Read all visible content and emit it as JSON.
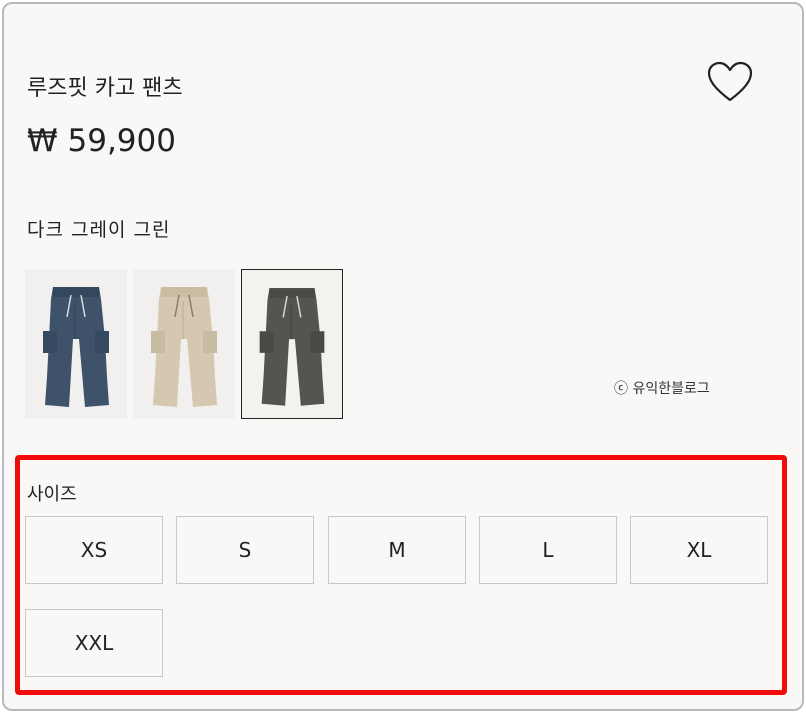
{
  "product": {
    "title": "루즈핏 카고 팬츠",
    "price": "₩ 59,900",
    "wishlist_icon": "heart-outline-icon"
  },
  "color": {
    "selected_name": "다크 그레이 그린",
    "swatches": [
      {
        "name": "navy",
        "hex": "#3e526a",
        "selected": false
      },
      {
        "name": "beige",
        "hex": "#d6c7b0",
        "selected": false
      },
      {
        "name": "dark-gray-green",
        "hex": "#52564e",
        "selected": true
      }
    ]
  },
  "watermark": "ⓒ 유익한블로그",
  "sizes": {
    "label": "사이즈",
    "options": [
      "XS",
      "S",
      "M",
      "L",
      "XL",
      "XXL"
    ]
  },
  "colors": {
    "highlight": "#f20b0b",
    "background": "#f9f8f6",
    "text": "#222222"
  }
}
